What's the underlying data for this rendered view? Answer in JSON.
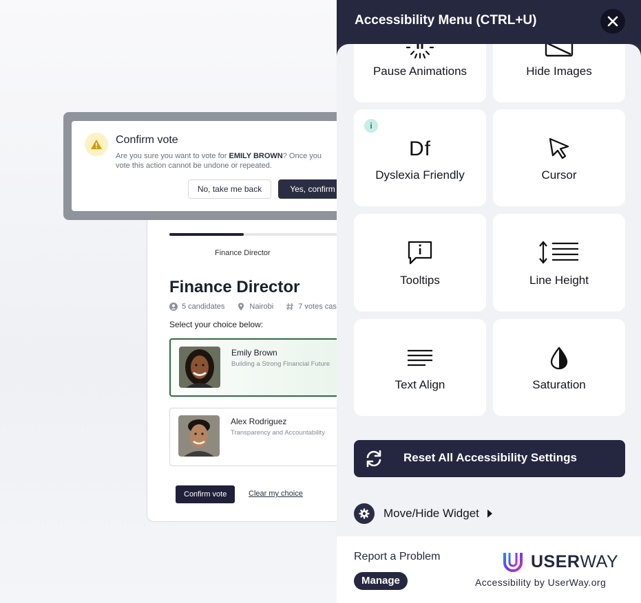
{
  "background_page": {
    "progress_percent": 36,
    "progress_caption": "Finance Director",
    "position_title": "Finance Director",
    "meta": {
      "candidates": "5 candidates",
      "location": "Nairobi",
      "votes": "7 votes cas"
    },
    "choice_prompt": "Select your choice below:",
    "candidates": [
      {
        "name": "Emily Brown",
        "tagline": "Building a Strong Financial Future",
        "selected": true
      },
      {
        "name": "Alex Rodriguez",
        "tagline": "Transparency and Accountability",
        "selected": false
      }
    ],
    "confirm_vote_label": "Confirm vote",
    "clear_choice_label": "Clear my choice"
  },
  "modal": {
    "title": "Confirm vote",
    "body_prefix": "Are you sure you want to vote for ",
    "body_name": "EMILY BROWN",
    "body_suffix": "? Once you",
    "body_line2": "vote this action cannot be undone or repeated.",
    "cancel_label": "No, take me back",
    "confirm_label": "Yes, confirm"
  },
  "panel": {
    "title": "Accessibility Menu (CTRL+U)",
    "tiles": [
      {
        "label": "Pause Animations",
        "icon": "pause-animations-icon"
      },
      {
        "label": "Hide Images",
        "icon": "hide-images-icon"
      },
      {
        "label": "Dyslexia Friendly",
        "icon": "dyslexia-icon",
        "glyph": "Df",
        "info": "i"
      },
      {
        "label": "Cursor",
        "icon": "cursor-icon"
      },
      {
        "label": "Tooltips",
        "icon": "tooltip-icon"
      },
      {
        "label": "Line Height",
        "icon": "line-height-icon"
      },
      {
        "label": "Text Align",
        "icon": "text-align-icon"
      },
      {
        "label": "Saturation",
        "icon": "saturation-icon"
      }
    ],
    "reset_label": "Reset All Accessibility Settings",
    "move_label": "Move/Hide Widget",
    "report_label": "Report a Problem",
    "manage_label": "Manage",
    "brand_bold": "USER",
    "brand_light": "WAY",
    "brand_sub": "Accessibility by UserWay.org"
  },
  "colors": {
    "panel_dark": "#262840",
    "tile_bg": "#ffffff",
    "panel_body_bg": "#f1f2f6",
    "selected_border": "#2f6b44"
  }
}
